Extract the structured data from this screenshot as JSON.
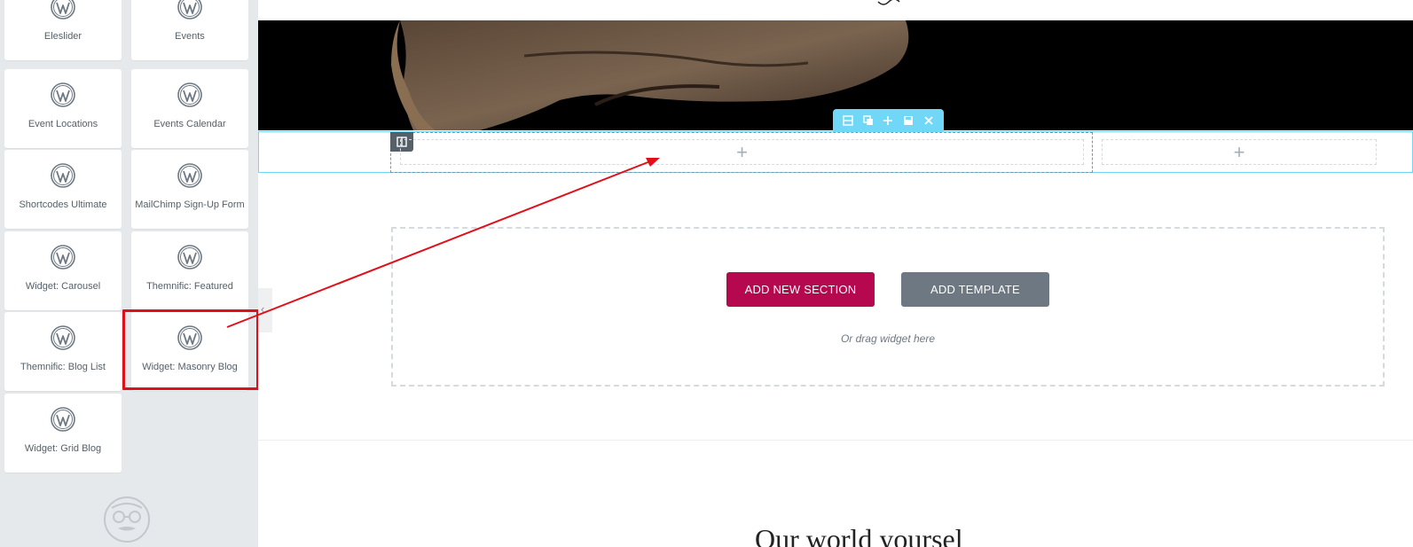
{
  "sidebar": {
    "widgets": [
      {
        "label": "Eleslider",
        "icon": "wordpress-icon"
      },
      {
        "label": "Events",
        "icon": "wordpress-icon"
      },
      {
        "label": "Event Locations",
        "icon": "wordpress-icon"
      },
      {
        "label": "Events Calendar",
        "icon": "wordpress-icon"
      },
      {
        "label": "Shortcodes Ultimate",
        "icon": "wordpress-icon"
      },
      {
        "label": "MailChimp Sign-Up Form",
        "icon": "wordpress-icon"
      },
      {
        "label": "Widget: Carousel",
        "icon": "wordpress-icon"
      },
      {
        "label": "Themnific: Featured",
        "icon": "wordpress-icon"
      },
      {
        "label": "Themnific: Blog List",
        "icon": "wordpress-icon"
      },
      {
        "label": "Widget: Masonry Blog",
        "icon": "wordpress-icon"
      },
      {
        "label": "Widget: Grid Blog",
        "icon": "wordpress-icon"
      }
    ],
    "highlighted_widget": "Widget: Masonry Blog",
    "collapse_glyph": "‹",
    "mascot_icon": "elementor-mascot-icon"
  },
  "editor": {
    "section_toolbar_icons": [
      "columns-icon",
      "duplicate-icon",
      "add-icon",
      "save-icon",
      "close-icon"
    ],
    "column_handle_icon": "column-icon",
    "add_glyph": "+",
    "add_section_label": "ADD NEW SECTION",
    "add_template_label": "ADD TEMPLATE",
    "drag_hint": "Or drag widget here",
    "bottom_heading": "Our world yoursel"
  },
  "colors": {
    "accent_pink": "#b5084e",
    "template_gray": "#6d7882",
    "section_border": "#71d7f7",
    "annotation_red": "#e0101a",
    "sidebar_bg": "#e6e9ec"
  }
}
